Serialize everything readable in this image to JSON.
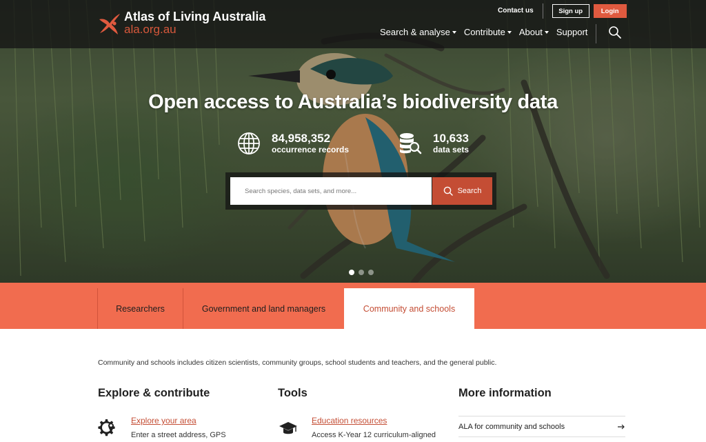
{
  "brand": {
    "name": "Atlas of Living Australia",
    "url": "ala.org.au",
    "accent": "#d5573b"
  },
  "utility": {
    "contact": "Contact us",
    "signup": "Sign up",
    "login": "Login"
  },
  "nav": {
    "items": [
      {
        "label": "Search & analyse",
        "dropdown": true
      },
      {
        "label": "Contribute",
        "dropdown": true
      },
      {
        "label": "About",
        "dropdown": true
      },
      {
        "label": "Support",
        "dropdown": false
      }
    ]
  },
  "hero": {
    "title": "Open access to Australia’s biodiversity data",
    "stats": [
      {
        "number": "84,958,352",
        "label": "occurrence records",
        "icon": "globe-icon"
      },
      {
        "number": "10,633",
        "label": "data sets",
        "icon": "database-search-icon"
      }
    ],
    "search": {
      "placeholder": "Search species, data sets, and more...",
      "button": "Search"
    },
    "carousel": {
      "slides": 3,
      "active": 1
    }
  },
  "tabs": [
    {
      "label": "Researchers",
      "active": false
    },
    {
      "label": "Government and land managers",
      "active": false
    },
    {
      "label": "Community and schools",
      "active": true
    }
  ],
  "content": {
    "intro": "Community and schools includes citizen scientists, community groups, school students and teachers, and the general public.",
    "columns": {
      "explore": {
        "heading": "Explore & contribute",
        "items": [
          {
            "title": "Explore your area",
            "desc": "Enter a street address, GPS",
            "icon": "location-gear-icon"
          }
        ]
      },
      "tools": {
        "heading": "Tools",
        "items": [
          {
            "title": "Education resources",
            "desc": "Access K-Year 12 curriculum-aligned",
            "icon": "graduation-cap-icon"
          }
        ]
      },
      "more": {
        "heading": "More information",
        "items": [
          {
            "label": "ALA for community and schools",
            "icon": "arrow-right-icon"
          }
        ]
      }
    }
  }
}
